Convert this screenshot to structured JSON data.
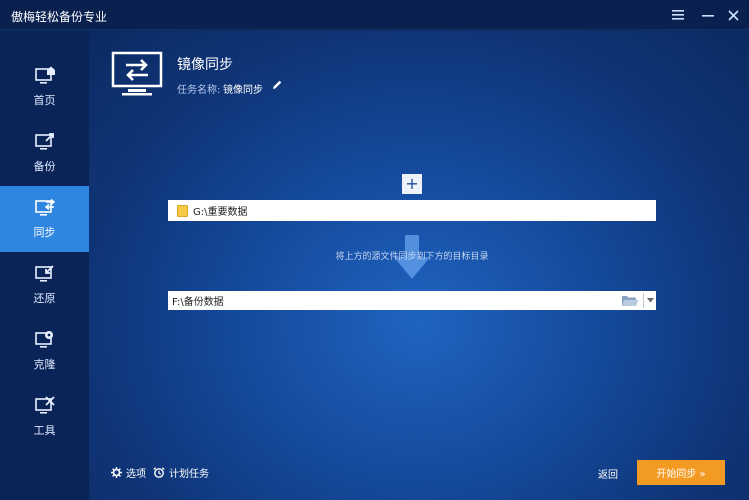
{
  "app": {
    "title": "傲梅轻松备份专业",
    "menu_icon": "menu-icon",
    "minimize_icon": "minimize-icon",
    "close_icon": "close-icon"
  },
  "sidebar": {
    "items": [
      {
        "label": "首页",
        "icon": "home-icon",
        "active": false
      },
      {
        "label": "备份",
        "icon": "backup-icon",
        "active": false
      },
      {
        "label": "同步",
        "icon": "sync-icon",
        "active": true
      },
      {
        "label": "还原",
        "icon": "restore-icon",
        "active": false
      },
      {
        "label": "克隆",
        "icon": "clone-icon",
        "active": false
      },
      {
        "label": "工具",
        "icon": "tools-icon",
        "active": false
      }
    ]
  },
  "main": {
    "title": "镜像同步",
    "task_name_label": "任务名称:",
    "task_name_value": "镜像同步",
    "add_label": "+",
    "source_path": "G:\\重要数据",
    "hint": "将上方的源文件同步到下方的目标目录",
    "destination_path": "F:\\备份数据"
  },
  "footer": {
    "options_label": "选项",
    "schedule_label": "计划任务",
    "back_label": "返回",
    "start_label": "开始同步 »"
  },
  "colors": {
    "accent_active": "#2f86e0",
    "start_button": "#f39a22",
    "background_dark": "#0b2457"
  }
}
